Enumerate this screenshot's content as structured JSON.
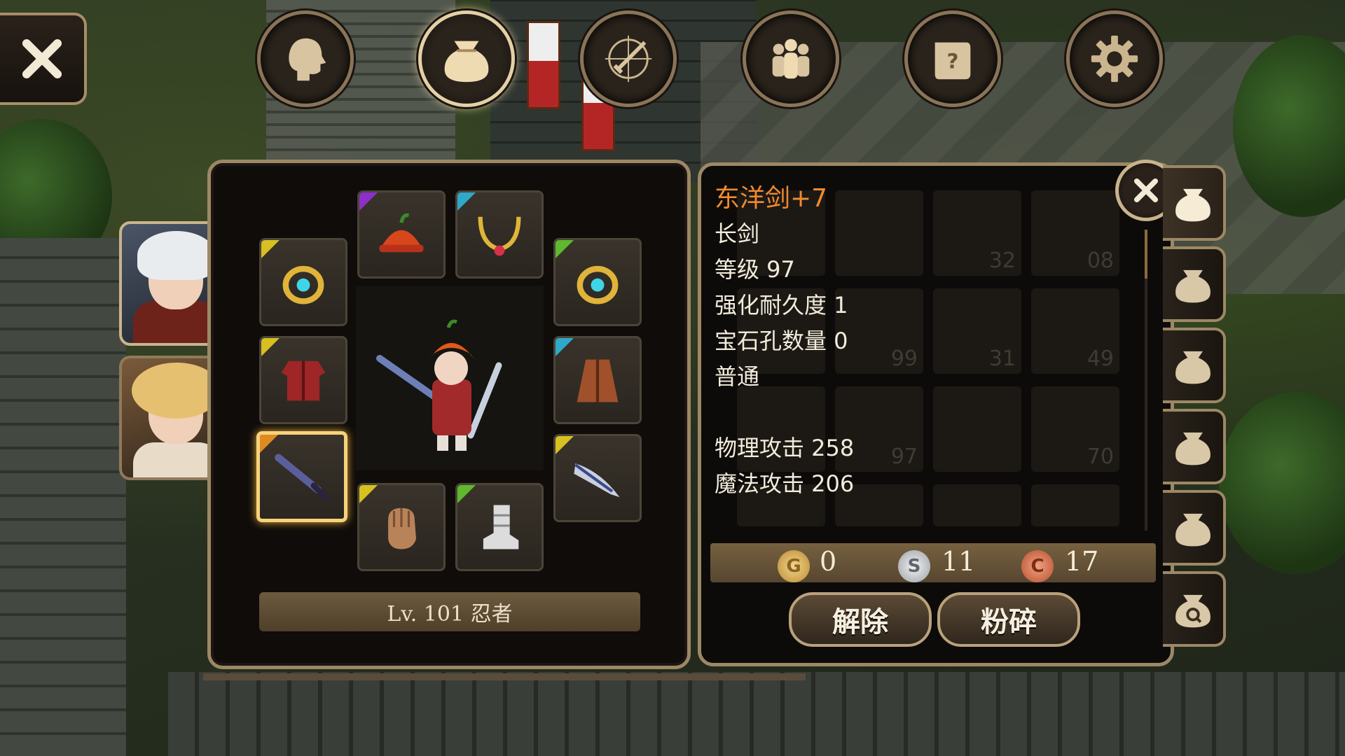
{
  "nav": {
    "close": "close-icon",
    "buttons": [
      {
        "name": "character",
        "icon": "head-icon"
      },
      {
        "name": "inventory",
        "icon": "bag-icon",
        "active": true
      },
      {
        "name": "skills",
        "icon": "sword-compass-icon"
      },
      {
        "name": "party",
        "icon": "people-icon"
      },
      {
        "name": "quest",
        "icon": "scroll-icon"
      },
      {
        "name": "settings",
        "icon": "gear-icon"
      }
    ]
  },
  "characters": [
    {
      "portrait": "white-haired-ninja-portrait",
      "selected": true
    },
    {
      "portrait": "blonde-girl-portrait",
      "selected": false
    }
  ],
  "equipment": {
    "slots": [
      {
        "slot": "helmet",
        "icon": "red-hat-icon",
        "rarity_color": "#8d2fc9"
      },
      {
        "slot": "necklace",
        "icon": "gold-necklace-icon",
        "rarity_color": "#2fa9c9"
      },
      {
        "slot": "ring-left",
        "icon": "gold-ring-icon",
        "rarity_color": "#d8c020"
      },
      {
        "slot": "ring-right",
        "icon": "gold-ring-icon",
        "rarity_color": "#5fb82e"
      },
      {
        "slot": "armor",
        "icon": "red-armor-icon",
        "rarity_color": "#d8c020"
      },
      {
        "slot": "cloak",
        "icon": "brown-coat-icon",
        "rarity_color": "#2fa9c9"
      },
      {
        "slot": "weapon",
        "icon": "dark-sword-icon",
        "rarity_color": "#e08a22",
        "selected": true
      },
      {
        "slot": "offhand",
        "icon": "blade-icon",
        "rarity_color": "#d8c020"
      },
      {
        "slot": "gloves",
        "icon": "leather-glove-icon",
        "rarity_color": "#d8c020"
      },
      {
        "slot": "boots",
        "icon": "white-boot-icon",
        "rarity_color": "#5fb82e"
      }
    ],
    "level_label": "Lv. 101 忍者"
  },
  "item_detail": {
    "name": "东洋剑+7",
    "type": "长剑",
    "level": "等级 97",
    "durability": "强化耐久度 1",
    "gem_slots": "宝石孔数量 0",
    "grade": "普通",
    "phys_attack": "物理攻击 258",
    "magic_attack": "魔法攻击 206",
    "name_color": "#f08a2e"
  },
  "inventory_background_counts": [
    "32",
    "08",
    "99",
    "31",
    "49",
    "97",
    "70"
  ],
  "currency": {
    "gold": "0",
    "silver": "11",
    "copper": "17"
  },
  "actions": {
    "unequip": "解除",
    "smash": "粉碎"
  },
  "bag_tabs": [
    {
      "icon": "bag-icon",
      "active": true
    },
    {
      "icon": "bag-icon"
    },
    {
      "icon": "bag-icon"
    },
    {
      "icon": "bag-icon"
    },
    {
      "icon": "bag-icon"
    },
    {
      "icon": "bag-search-icon"
    }
  ]
}
